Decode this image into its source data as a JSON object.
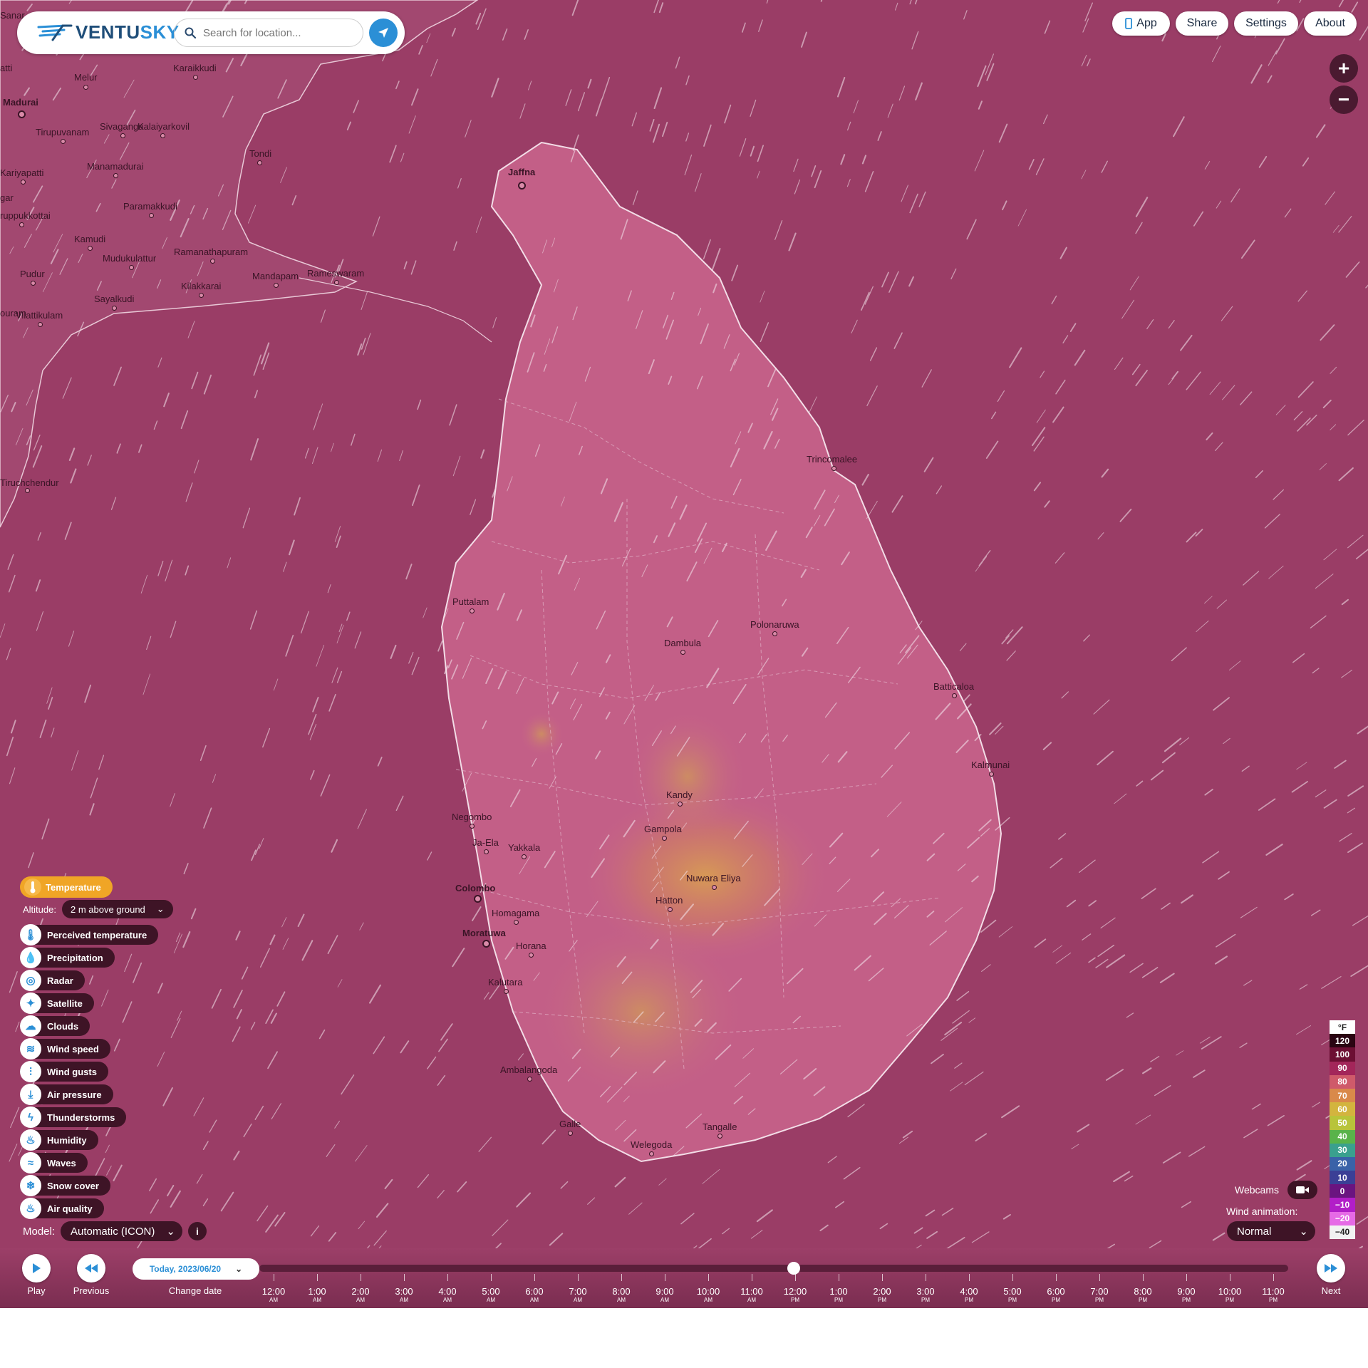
{
  "header": {
    "logo_text_a": "VENTU",
    "logo_text_b": "SKY",
    "search_placeholder": "Search for location..."
  },
  "top_buttons": {
    "app": "App",
    "share": "Share",
    "settings": "Settings",
    "about": "About"
  },
  "zoom": {
    "in": "+",
    "out": "−"
  },
  "layers": {
    "active": "Temperature",
    "altitude_label": "Altitude:",
    "altitude_value": "2 m above ground",
    "items": [
      {
        "label": "Perceived temperature",
        "icon": "perceived-temperature-icon"
      },
      {
        "label": "Precipitation",
        "icon": "precipitation-icon"
      },
      {
        "label": "Radar",
        "icon": "radar-icon"
      },
      {
        "label": "Satellite",
        "icon": "satellite-icon"
      },
      {
        "label": "Clouds",
        "icon": "clouds-icon"
      },
      {
        "label": "Wind speed",
        "icon": "wind-speed-icon"
      },
      {
        "label": "Wind gusts",
        "icon": "wind-gusts-icon"
      },
      {
        "label": "Air pressure",
        "icon": "air-pressure-icon"
      },
      {
        "label": "Thunderstorms",
        "icon": "thunderstorms-icon"
      },
      {
        "label": "Humidity",
        "icon": "humidity-icon"
      },
      {
        "label": "Waves",
        "icon": "waves-icon"
      },
      {
        "label": "Snow cover",
        "icon": "snow-cover-icon"
      },
      {
        "label": "Air quality",
        "icon": "air-quality-icon"
      }
    ],
    "model_label": "Model:",
    "model_value": "Automatic (ICON)",
    "info": "i"
  },
  "webcams": "Webcams",
  "wind_animation": {
    "label": "Wind animation:",
    "value": "Normal"
  },
  "legend": {
    "unit": "°F",
    "entries": [
      {
        "value": "120",
        "color": "#2a0512"
      },
      {
        "value": "100",
        "color": "#6c0f33"
      },
      {
        "value": "90",
        "color": "#a3265a"
      },
      {
        "value": "80",
        "color": "#cf5a6a"
      },
      {
        "value": "70",
        "color": "#d9894a"
      },
      {
        "value": "60",
        "color": "#d3b43e"
      },
      {
        "value": "50",
        "color": "#b8c43a"
      },
      {
        "value": "40",
        "color": "#59b34a"
      },
      {
        "value": "30",
        "color": "#3aa08e"
      },
      {
        "value": "20",
        "color": "#3a62a8"
      },
      {
        "value": "10",
        "color": "#3b3f96"
      },
      {
        "value": "0",
        "color": "#6a1480"
      },
      {
        "value": "−10",
        "color": "#b21ec8"
      },
      {
        "value": "−20",
        "color": "#e66ae6"
      },
      {
        "value": "−40",
        "color": "#f2f2f2"
      }
    ]
  },
  "timeline": {
    "play": "Play",
    "previous": "Previous",
    "next": "Next",
    "change_date": "Change date",
    "date": "Today, 2023/06/20",
    "hours": [
      {
        "t": "12:00",
        "ap": "AM"
      },
      {
        "t": "1:00",
        "ap": "AM"
      },
      {
        "t": "2:00",
        "ap": "AM"
      },
      {
        "t": "3:00",
        "ap": "AM"
      },
      {
        "t": "4:00",
        "ap": "AM"
      },
      {
        "t": "5:00",
        "ap": "AM"
      },
      {
        "t": "6:00",
        "ap": "AM"
      },
      {
        "t": "7:00",
        "ap": "AM"
      },
      {
        "t": "8:00",
        "ap": "AM"
      },
      {
        "t": "9:00",
        "ap": "AM"
      },
      {
        "t": "10:00",
        "ap": "AM"
      },
      {
        "t": "11:00",
        "ap": "AM"
      },
      {
        "t": "12:00",
        "ap": "PM"
      },
      {
        "t": "1:00",
        "ap": "PM"
      },
      {
        "t": "2:00",
        "ap": "PM"
      },
      {
        "t": "3:00",
        "ap": "PM"
      },
      {
        "t": "4:00",
        "ap": "PM"
      },
      {
        "t": "5:00",
        "ap": "PM"
      },
      {
        "t": "6:00",
        "ap": "PM"
      },
      {
        "t": "7:00",
        "ap": "PM"
      },
      {
        "t": "8:00",
        "ap": "PM"
      },
      {
        "t": "9:00",
        "ap": "PM"
      },
      {
        "t": "10:00",
        "ap": "PM"
      },
      {
        "t": "11:00",
        "ap": "PM"
      }
    ],
    "current_hour_index": 12
  },
  "cities": [
    {
      "name": "Jaffna",
      "major": true
    },
    {
      "name": "Trincomalee",
      "major": false
    },
    {
      "name": "Puttalam",
      "major": false
    },
    {
      "name": "Dambula",
      "major": false
    },
    {
      "name": "Polonaruwa",
      "major": false
    },
    {
      "name": "Batticaloa",
      "major": false
    },
    {
      "name": "Kalmunai",
      "major": false
    },
    {
      "name": "Kandy",
      "major": false
    },
    {
      "name": "Negombo",
      "major": false
    },
    {
      "name": "Gampola",
      "major": false
    },
    {
      "name": "Ja-Ela",
      "major": false
    },
    {
      "name": "Yakkala",
      "major": false
    },
    {
      "name": "Nuwara Eliya",
      "major": false
    },
    {
      "name": "Colombo",
      "major": true
    },
    {
      "name": "Hatton",
      "major": false
    },
    {
      "name": "Homagama",
      "major": false
    },
    {
      "name": "Moratuwa",
      "major": true
    },
    {
      "name": "Horana",
      "major": false
    },
    {
      "name": "Kalutara",
      "major": false
    },
    {
      "name": "Ambalangoda",
      "major": false
    },
    {
      "name": "Galle",
      "major": false
    },
    {
      "name": "Tangalle",
      "major": false
    },
    {
      "name": "Welegoda",
      "major": false
    },
    {
      "name": "Madurai",
      "major": true
    },
    {
      "name": "Melur",
      "major": false
    },
    {
      "name": "Karaikkudi",
      "major": false
    },
    {
      "name": "Sivaganga",
      "major": false
    },
    {
      "name": "Kalaiyarkovil",
      "major": false
    },
    {
      "name": "Tirupuvanam",
      "major": false
    },
    {
      "name": "Manamadurai",
      "major": false
    },
    {
      "name": "Tondi",
      "major": false
    },
    {
      "name": "Kariyapatti",
      "major": false
    },
    {
      "name": "Paramakkudi",
      "major": false
    },
    {
      "name": "ruppukkottai",
      "major": false
    },
    {
      "name": "Kamudi",
      "major": false
    },
    {
      "name": "Mudukulattur",
      "major": false
    },
    {
      "name": "Ramanathapuram",
      "major": false
    },
    {
      "name": "Pudur",
      "major": false
    },
    {
      "name": "Mandapam",
      "major": false
    },
    {
      "name": "Rameswaram",
      "major": false
    },
    {
      "name": "Kilakkarai",
      "major": false
    },
    {
      "name": "Sayalkudi",
      "major": false
    },
    {
      "name": "Vilattikulam",
      "major": false
    },
    {
      "name": "Tiruchchendur",
      "major": false
    },
    {
      "name": "Sanar",
      "major": false
    },
    {
      "name": "atti",
      "major": false
    },
    {
      "name": "gar",
      "major": false
    },
    {
      "name": "ouram",
      "major": false
    }
  ]
}
